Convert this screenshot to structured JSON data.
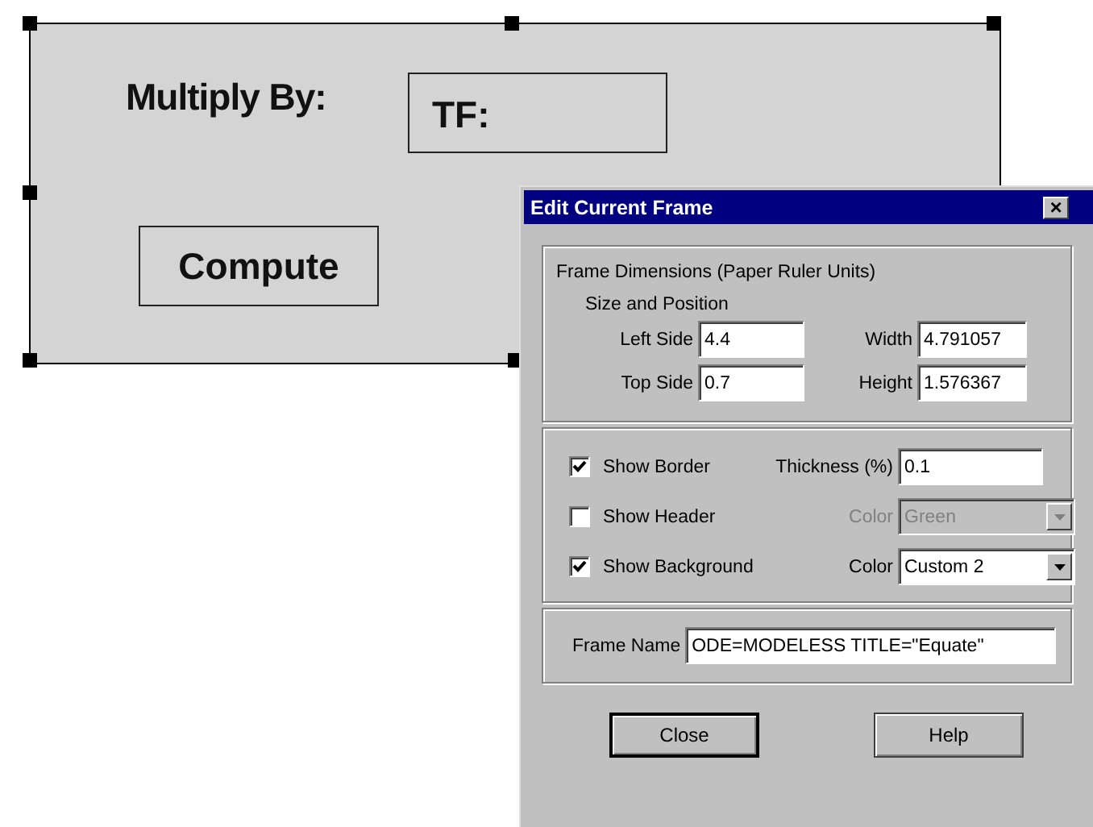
{
  "canvas": {
    "selected": true,
    "label": "Multiply By:",
    "field_label": "TF:",
    "button": "Compute"
  },
  "dialog": {
    "title": "Edit Current Frame",
    "close": "×",
    "dimensions": {
      "title": "Frame Dimensions (Paper Ruler Units)",
      "subtitle": "Size and Position",
      "fields": [
        {
          "label": "Left Side",
          "value": "4.4"
        },
        {
          "label": "Width",
          "value": "4.791057"
        },
        {
          "label": "Top Side",
          "value": "0.7"
        },
        {
          "label": "Height",
          "value": "1.576367"
        }
      ]
    },
    "options": [
      {
        "label": "Show Border",
        "checked": true,
        "control": {
          "kind": "input",
          "label": "Thickness (%)",
          "value": "0.1",
          "disabled": false
        }
      },
      {
        "label": "Show Header",
        "checked": false,
        "control": {
          "kind": "select",
          "label": "Color",
          "value": "Green",
          "disabled": true
        }
      },
      {
        "label": "Show Background",
        "checked": true,
        "control": {
          "kind": "select",
          "label": "Color",
          "value": "Custom 2",
          "disabled": false
        }
      }
    ],
    "frame_name": {
      "label": "Frame Name",
      "value": "ODE=MODELESS TITLE=\"Equate\""
    },
    "buttons": [
      {
        "label": "Close",
        "default": true
      },
      {
        "label": "Help",
        "default": false
      }
    ]
  }
}
